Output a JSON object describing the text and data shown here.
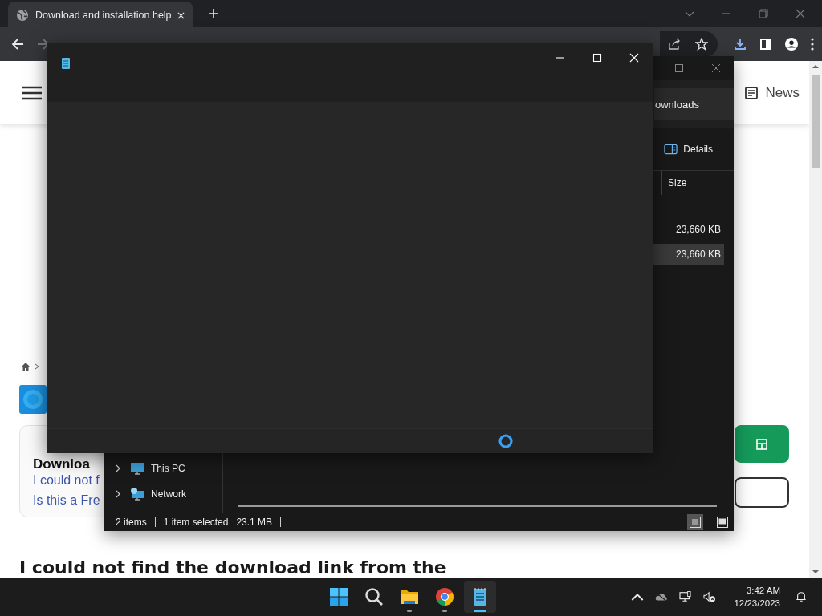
{
  "browser": {
    "tab": {
      "title": "Download and installation help",
      "selected": true
    },
    "header": {
      "nav_link": "News"
    },
    "page": {
      "card": {
        "title": "Downloa",
        "links": [
          "I could not f",
          "Is this a Fre"
        ]
      },
      "heading": "I could not find the download link from the"
    }
  },
  "explorer": {
    "address": "ownloads",
    "details_button": "Details",
    "column": "Size",
    "rows": [
      {
        "size": "23,660 KB",
        "selected": false
      },
      {
        "size": "23,660 KB",
        "selected": true
      }
    ],
    "nav_items": [
      {
        "label": "This PC",
        "kind": "pc"
      },
      {
        "label": "Network",
        "kind": "network"
      }
    ],
    "status": {
      "items": "2 items",
      "selected": "1 item selected",
      "size": "23.1 MB"
    },
    "views": [
      {
        "kind": "details",
        "selected": true
      },
      {
        "kind": "tiles",
        "selected": false
      }
    ]
  },
  "notepad": {
    "loading": true
  },
  "taskbar": {
    "apps": [
      {
        "kind": "start",
        "running": false,
        "selected": false
      },
      {
        "kind": "search",
        "running": false,
        "selected": false
      },
      {
        "kind": "explorer",
        "running": true,
        "selected": false
      },
      {
        "kind": "chrome",
        "running": true,
        "selected": false
      },
      {
        "kind": "notepad",
        "running": true,
        "selected": true
      }
    ],
    "time": "3:42 AM",
    "date": "12/23/2023"
  }
}
